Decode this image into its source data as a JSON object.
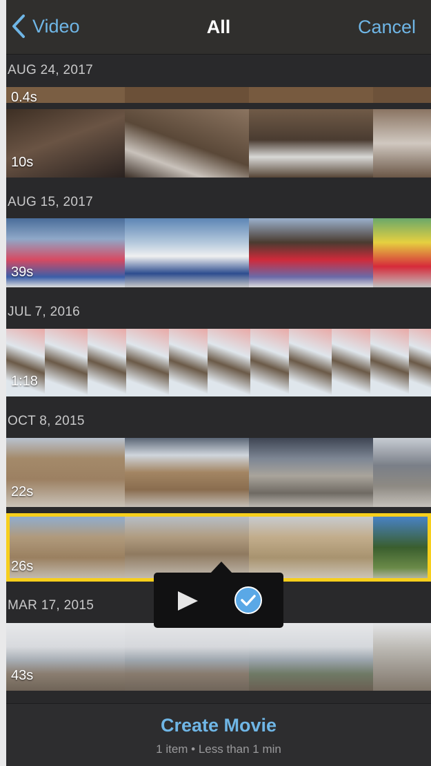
{
  "nav": {
    "back_label": "Video",
    "title": "All",
    "cancel_label": "Cancel"
  },
  "sections": [
    {
      "date": "AUG 24, 2017",
      "clips": [
        {
          "duration": "0.4s"
        },
        {
          "duration": "10s"
        }
      ]
    },
    {
      "date": "AUG 15, 2017",
      "clips": [
        {
          "duration": "39s"
        }
      ]
    },
    {
      "date": "JUL 7, 2016",
      "clips": [
        {
          "duration": "1:18"
        }
      ]
    },
    {
      "date": "OCT 8, 2015",
      "clips": [
        {
          "duration": "22s"
        },
        {
          "duration": "26s",
          "selected": true
        }
      ]
    },
    {
      "date": "MAR 17, 2015",
      "clips": [
        {
          "duration": "43s"
        }
      ]
    }
  ],
  "popover": {
    "play_icon": "play-icon",
    "select_icon": "checkmark-circle-icon"
  },
  "footer": {
    "create_label": "Create Movie",
    "summary": "1 item • Less than 1 min"
  },
  "colors": {
    "accent": "#6fb6e6",
    "selection": "#f7cf1c",
    "background": "#29292b"
  }
}
